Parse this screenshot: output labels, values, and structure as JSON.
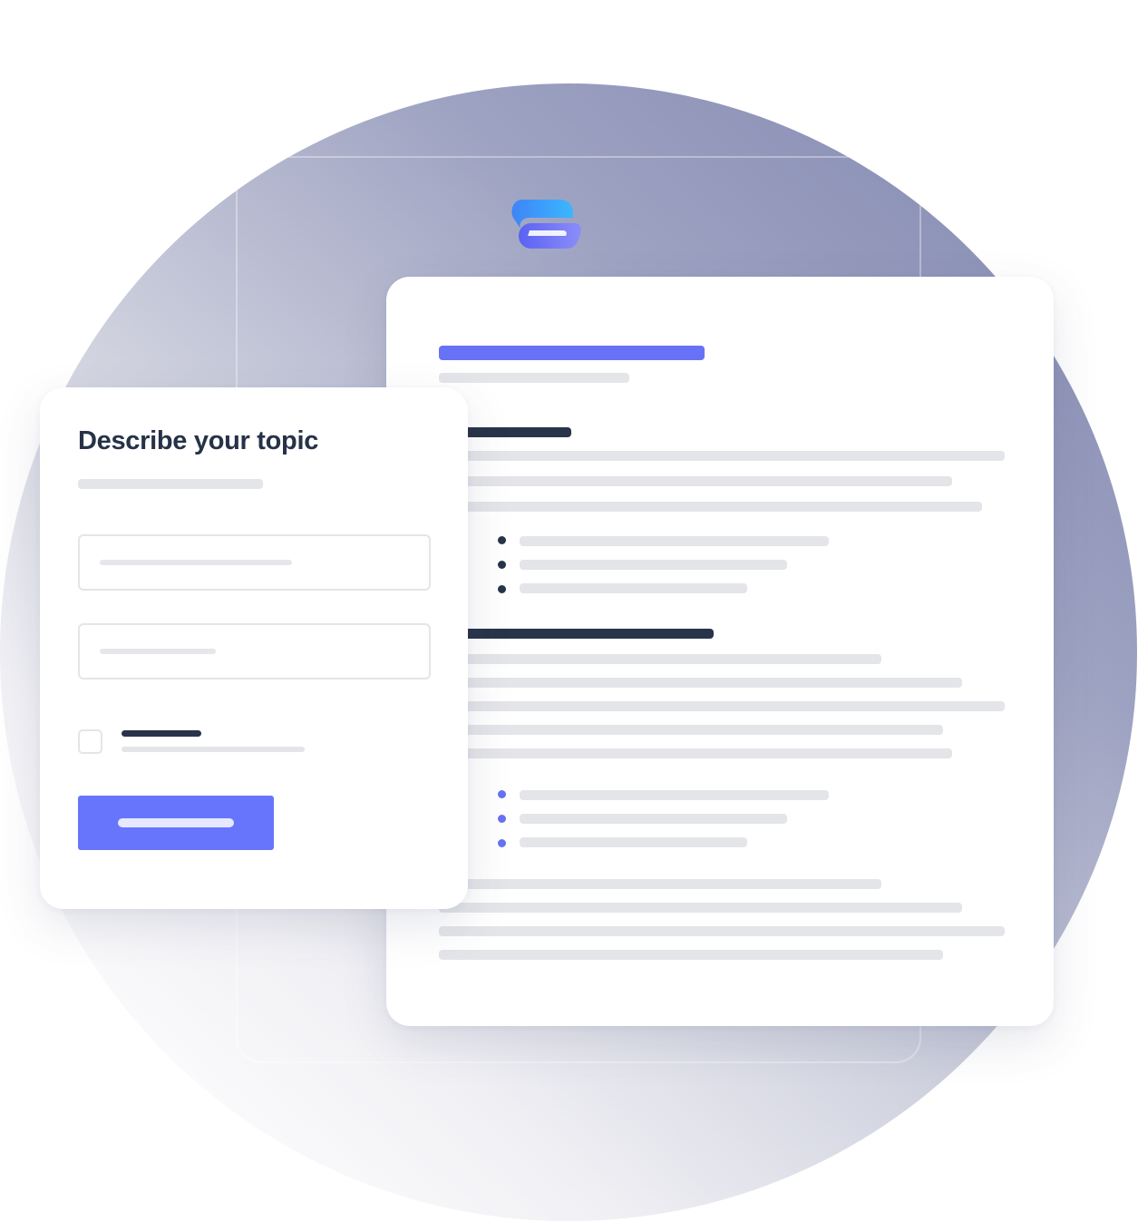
{
  "colors": {
    "accent": "#6675fb",
    "heading_dark": "#263247",
    "placeholder_bar": "#e4e5e9"
  },
  "logo": {
    "icon": "app-logo-icon"
  },
  "form": {
    "title": "Describe your topic"
  },
  "document": {
    "bullet_groups": 2,
    "bullets_per_group": 3
  }
}
